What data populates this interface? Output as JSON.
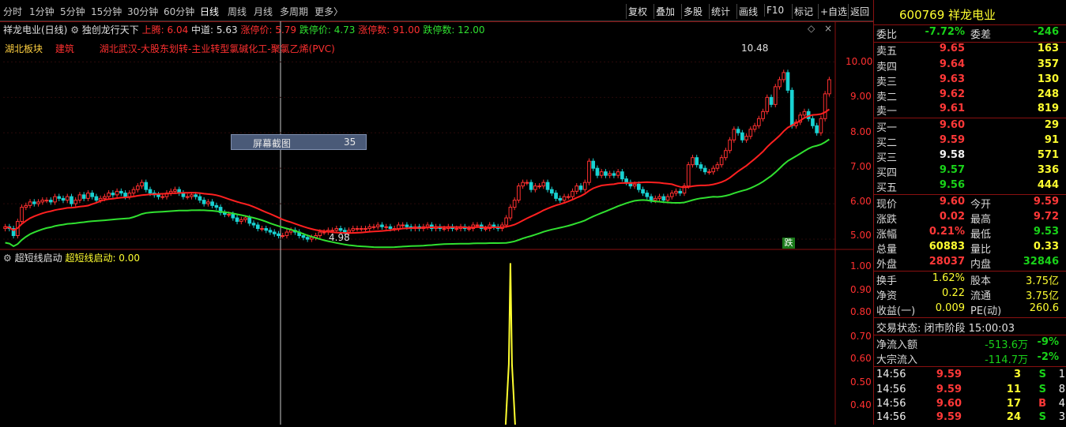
{
  "toolbar": {
    "periods": [
      "分时",
      "1分钟",
      "5分钟",
      "15分钟",
      "30分钟",
      "60分钟",
      "日线",
      "周线",
      "月线",
      "多周期",
      "更多〉"
    ],
    "active_period": "日线",
    "right_buttons": [
      "复权",
      "叠加",
      "多股",
      "统计",
      "画线",
      "F10",
      "标记",
      "+自选",
      "返回"
    ]
  },
  "header": {
    "stock_title": "祥龙电业(日线)",
    "indicator_name": "独创龙行天下",
    "upper_label": "上腾: 6.04",
    "mid_label": "中道: 5.63",
    "limit_up_label": "涨停价: 5.79",
    "limit_down_label": "跌停价: 4.73",
    "limit_up_count": "涨停数: 91.00",
    "limit_down_count": "跌停数: 12.00"
  },
  "info_line": {
    "sector": "湖北板块",
    "industry": "建筑",
    "concepts": "湖北武汉-大股东划转-主业转型氯碱化工-聚氯乙烯(PVC)"
  },
  "tooltip": {
    "label": "屏幕截图",
    "value": "35"
  },
  "annotations": {
    "high": "10.48",
    "low": "4.98",
    "fall_tag": "跌"
  },
  "price_axis": [
    "10.00",
    "9.00",
    "8.00",
    "7.00",
    "6.00",
    "5.00"
  ],
  "sub_header": {
    "name": "超短线启动",
    "value_label": "超短线启动: 0.00"
  },
  "sub_axis": [
    "1.00",
    "0.90",
    "0.80",
    "0.70",
    "0.60",
    "0.50",
    "0.40"
  ],
  "quote": {
    "code": "600769",
    "name": "祥龙电业",
    "weibi_label": "委比",
    "weibi": "-7.72%",
    "weicha_label": "委差",
    "weicha": "-246",
    "asks": [
      {
        "label": "卖五",
        "price": "9.65",
        "vol": "163"
      },
      {
        "label": "卖四",
        "price": "9.64",
        "vol": "357"
      },
      {
        "label": "卖三",
        "price": "9.63",
        "vol": "130"
      },
      {
        "label": "卖二",
        "price": "9.62",
        "vol": "248"
      },
      {
        "label": "卖一",
        "price": "9.61",
        "vol": "819"
      }
    ],
    "bids": [
      {
        "label": "买一",
        "price": "9.60",
        "vol": "29"
      },
      {
        "label": "买二",
        "price": "9.59",
        "vol": "91"
      },
      {
        "label": "买三",
        "price": "9.58",
        "vol": "571"
      },
      {
        "label": "买四",
        "price": "9.57",
        "vol": "336"
      },
      {
        "label": "买五",
        "price": "9.56",
        "vol": "444"
      }
    ],
    "stats": [
      {
        "l1": "现价",
        "v1": "9.60",
        "l2": "今开",
        "v2": "9.59"
      },
      {
        "l1": "涨跌",
        "v1": "0.02",
        "l2": "最高",
        "v2": "9.72"
      },
      {
        "l1": "涨幅",
        "v1": "0.21%",
        "l2": "最低",
        "v2": "9.53"
      },
      {
        "l1": "总量",
        "v1": "60883",
        "l2": "量比",
        "v2": "0.33"
      },
      {
        "l1": "外盘",
        "v1": "28037",
        "l2": "内盘",
        "v2": "32846"
      }
    ],
    "fund": [
      {
        "l1": "换手",
        "v1": "1.62%",
        "l2": "股本",
        "v2": "3.75亿"
      },
      {
        "l1": "净资",
        "v1": "0.22",
        "l2": "流通",
        "v2": "3.75亿"
      },
      {
        "l1": "收益(一)",
        "v1": "0.009",
        "l2": "PE(动)",
        "v2": "260.6"
      }
    ],
    "trade_status": "交易状态: 闭市阶段 15:00:03",
    "flows": [
      {
        "label": "净流入额",
        "value": "-513.6万",
        "pct": "-9%"
      },
      {
        "label": "大宗流入",
        "value": "-114.7万",
        "pct": "-2%"
      }
    ],
    "ticks": [
      {
        "time": "14:56",
        "price": "9.59",
        "vol": "3",
        "side": "S",
        "n": "1"
      },
      {
        "time": "14:56",
        "price": "9.59",
        "vol": "11",
        "side": "S",
        "n": "8"
      },
      {
        "time": "14:56",
        "price": "9.60",
        "vol": "17",
        "side": "B",
        "n": "4"
      },
      {
        "time": "14:56",
        "price": "9.59",
        "vol": "24",
        "side": "S",
        "n": "3"
      }
    ]
  },
  "chart_data": {
    "type": "candlestick",
    "y_range": [
      4.8,
      10.7
    ],
    "closes": [
      5.35,
      5.3,
      5.1,
      5.5,
      5.9,
      5.95,
      6.05,
      6.0,
      6.05,
      6.1,
      6.1,
      6.05,
      6.2,
      6.15,
      6.1,
      6.2,
      6.0,
      6.1,
      6.25,
      6.15,
      6.3,
      6.2,
      6.1,
      6.15,
      6.2,
      6.3,
      6.25,
      6.35,
      6.3,
      6.2,
      6.3,
      6.4,
      6.5,
      6.6,
      6.4,
      6.3,
      6.25,
      6.2,
      6.2,
      6.3,
      6.35,
      6.4,
      6.3,
      6.2,
      6.2,
      6.25,
      6.2,
      6.1,
      6.0,
      6.05,
      5.95,
      5.9,
      5.75,
      5.7,
      5.7,
      5.6,
      5.5,
      5.55,
      5.6,
      5.45,
      5.4,
      5.3,
      5.3,
      5.25,
      5.2,
      5.15,
      5.1,
      5.1,
      5.2,
      5.25,
      5.2,
      5.1,
      5.05,
      5.0,
      5.05,
      5.1,
      5.2,
      5.2,
      5.25,
      5.25,
      5.3,
      5.25,
      5.2,
      5.25,
      5.3,
      5.3,
      5.3,
      5.3,
      5.35,
      5.35,
      5.4,
      5.35,
      5.35,
      5.3,
      5.3,
      5.4,
      5.4,
      5.35,
      5.3,
      5.35,
      5.3,
      5.35,
      5.4,
      5.3,
      5.35,
      5.3,
      5.3,
      5.35,
      5.3,
      5.3,
      5.35,
      5.3,
      5.3,
      5.4,
      5.4,
      5.3,
      5.3,
      5.4,
      5.35,
      5.3,
      5.4,
      5.6,
      5.9,
      6.1,
      6.5,
      6.6,
      6.6,
      6.4,
      6.5,
      6.5,
      6.6,
      6.4,
      6.3,
      6.15,
      6.1,
      6.2,
      6.2,
      6.35,
      6.5,
      6.4,
      6.6,
      7.2,
      7.0,
      6.8,
      6.9,
      6.8,
      6.85,
      6.8,
      6.9,
      6.7,
      6.6,
      6.5,
      6.55,
      6.4,
      6.3,
      6.2,
      6.1,
      6.15,
      6.2,
      6.1,
      6.2,
      6.3,
      6.35,
      6.3,
      6.5,
      7.1,
      7.3,
      7.1,
      7.0,
      6.9,
      6.9,
      7.0,
      7.1,
      7.3,
      7.5,
      7.8,
      8.1,
      8.0,
      7.8,
      7.9,
      8.1,
      8.2,
      8.4,
      8.6,
      9.0,
      8.8,
      9.3,
      9.5,
      9.7,
      9.2,
      8.2,
      8.3,
      8.5,
      8.6,
      8.4,
      8.2,
      8.0,
      8.4,
      9.1,
      9.5
    ],
    "ma_red_endpoints": [
      6.05,
      8.1
    ],
    "ma_green_endpoints": [
      5.55,
      7.6
    ],
    "sub_chart": {
      "spike_index": 122,
      "spike_value": 1.0,
      "y_range": [
        0.36,
        1.02
      ]
    }
  }
}
